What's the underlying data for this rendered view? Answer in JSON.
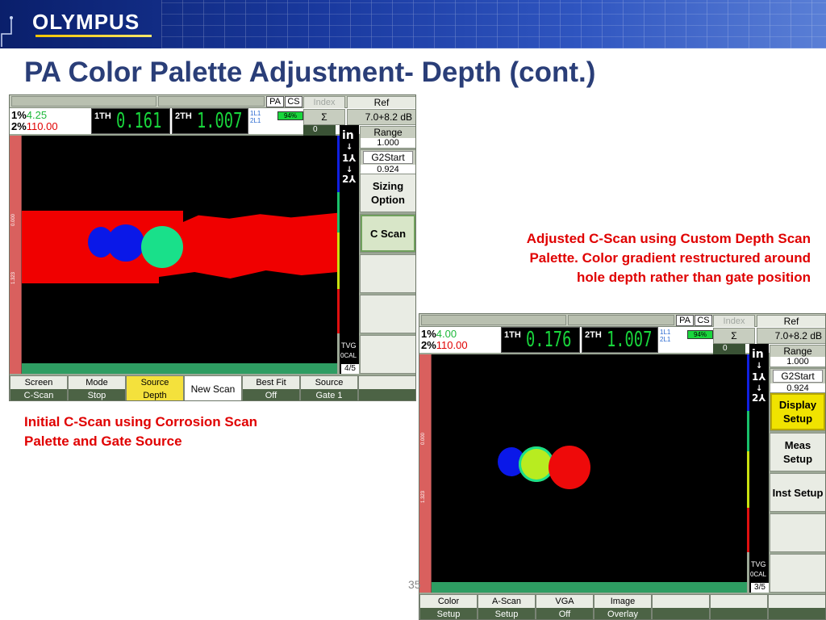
{
  "header": {
    "brand": "OLYMPUS",
    "title": "PA Color Palette Adjustment- Depth (cont.)",
    "colors": {
      "banner": "#1a3aa0",
      "title": "#2a3e78",
      "caption": "#e00000"
    }
  },
  "captions": {
    "left": "Initial C-Scan using Corrosion Scan Palette and Gate Source",
    "right": "Adjusted C-Scan using Custom Depth Scan Palette.  Color gradient restructured around hole depth rather than gate position"
  },
  "page_number": "35",
  "screen1": {
    "pa": "PA",
    "cs": "CS",
    "index": "Index",
    "ref": "Ref",
    "pct1_label": "1%",
    "pct1_value": "4.25",
    "pct2_label": "2%",
    "pct2_value": "110.00",
    "th1_label": "1TH",
    "th1_value": "0.161",
    "th2_label": "2TH",
    "th2_value": "1.007",
    "gate_l1": "1L1",
    "gate_l2": "2L1",
    "battery": "94%",
    "sigma": "Σ",
    "gain": "7.0+8.2  dB",
    "zero": "0",
    "unit": "in",
    "marker1": "1",
    "marker2": "2",
    "tvg": "TVG",
    "cal": "0CAL",
    "page": "4/5",
    "axis_top": "0.000",
    "axis_bot": "1.323",
    "range_label": "Range",
    "range_value": "1.000",
    "g2start_label": "G2Start",
    "g2start_value": "0.924",
    "panel": [
      "Sizing Option",
      "C Scan",
      "",
      "",
      ""
    ],
    "softkeys": [
      {
        "top": "Screen",
        "bottom": "C-Scan"
      },
      {
        "top": "Mode",
        "bottom": "Stop"
      },
      {
        "top": "Source",
        "bottom": "Depth"
      },
      {
        "single": "New Scan"
      },
      {
        "top": "Best Fit",
        "bottom": "Off"
      },
      {
        "top": "Source",
        "bottom": "Gate 1"
      },
      {
        "top": "",
        "bottom": ""
      }
    ]
  },
  "screen2": {
    "pa": "PA",
    "cs": "CS",
    "index": "Index",
    "ref": "Ref",
    "pct1_label": "1%",
    "pct1_value": "4.00",
    "pct2_label": "2%",
    "pct2_value": "110.00",
    "th1_label": "1TH",
    "th1_value": "0.176",
    "th2_label": "2TH",
    "th2_value": "1.007",
    "gate_l1": "1L1",
    "gate_l2": "2L1",
    "battery": "94%",
    "sigma": "Σ",
    "gain": "7.0+8.2  dB",
    "zero": "0",
    "unit": "in",
    "marker1": "1",
    "marker2": "2",
    "tvg": "TVG",
    "cal": "0CAL",
    "page": "3/5",
    "axis_top": "0.000",
    "axis_bot": "1.323",
    "range_label": "Range",
    "range_value": "1.000",
    "g2start_label": "G2Start",
    "g2start_value": "0.924",
    "panel": [
      "Display Setup",
      "Meas Setup",
      "Inst Setup",
      "",
      ""
    ],
    "softkeys": [
      {
        "top": "Color",
        "bottom": "Setup"
      },
      {
        "top": "A-Scan",
        "bottom": "Setup"
      },
      {
        "top": "VGA",
        "bottom": "Off"
      },
      {
        "top": "Image",
        "bottom": "Overlay"
      },
      {
        "top": "",
        "bottom": ""
      },
      {
        "top": "",
        "bottom": ""
      },
      {
        "top": "",
        "bottom": ""
      }
    ]
  }
}
